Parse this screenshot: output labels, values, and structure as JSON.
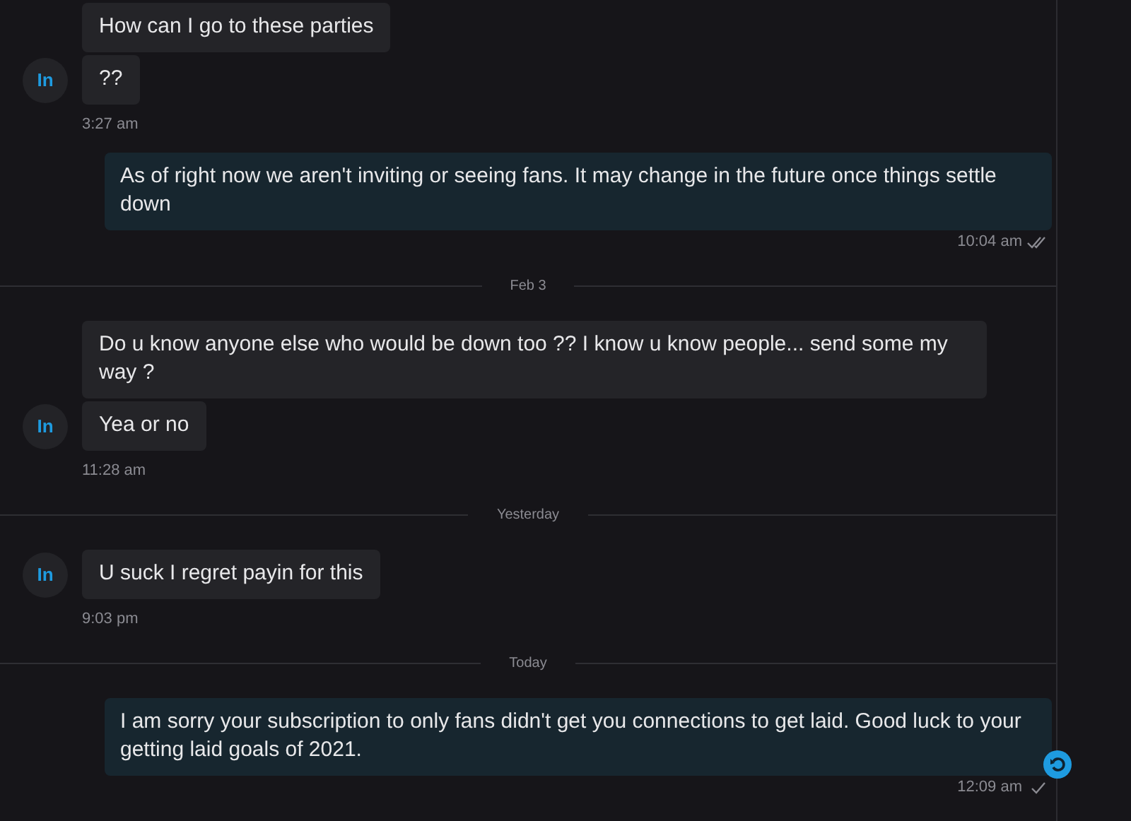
{
  "messages": [
    {
      "kind": "incoming",
      "bubbles": [
        "How can I go to these parties",
        "??"
      ],
      "avatar": "In",
      "time": "3:27 am"
    },
    {
      "kind": "outgoing",
      "text": "As of right now we aren't inviting or seeing fans. It may change in the future once things settle down",
      "time": "10:04 am",
      "read": true,
      "hovered": false
    },
    {
      "kind": "divider",
      "label": "Feb 3"
    },
    {
      "kind": "incoming",
      "bubbles": [
        "Do u know anyone else who would be down too ?? I know u know people... send some my way ?",
        "Yea or no"
      ],
      "avatar": "In",
      "time": "11:28 am"
    },
    {
      "kind": "divider",
      "label": "Yesterday"
    },
    {
      "kind": "incoming",
      "bubbles": [
        "U suck I regret payin for this"
      ],
      "avatar": "In",
      "time": "9:03 pm"
    },
    {
      "kind": "divider",
      "label": "Today"
    },
    {
      "kind": "outgoing",
      "text": "I am sorry your subscription to only fans didn't get you connections to get laid. Good luck to your getting laid goals of 2021.",
      "time": "12:09 am",
      "read": false,
      "hovered": true
    }
  ]
}
